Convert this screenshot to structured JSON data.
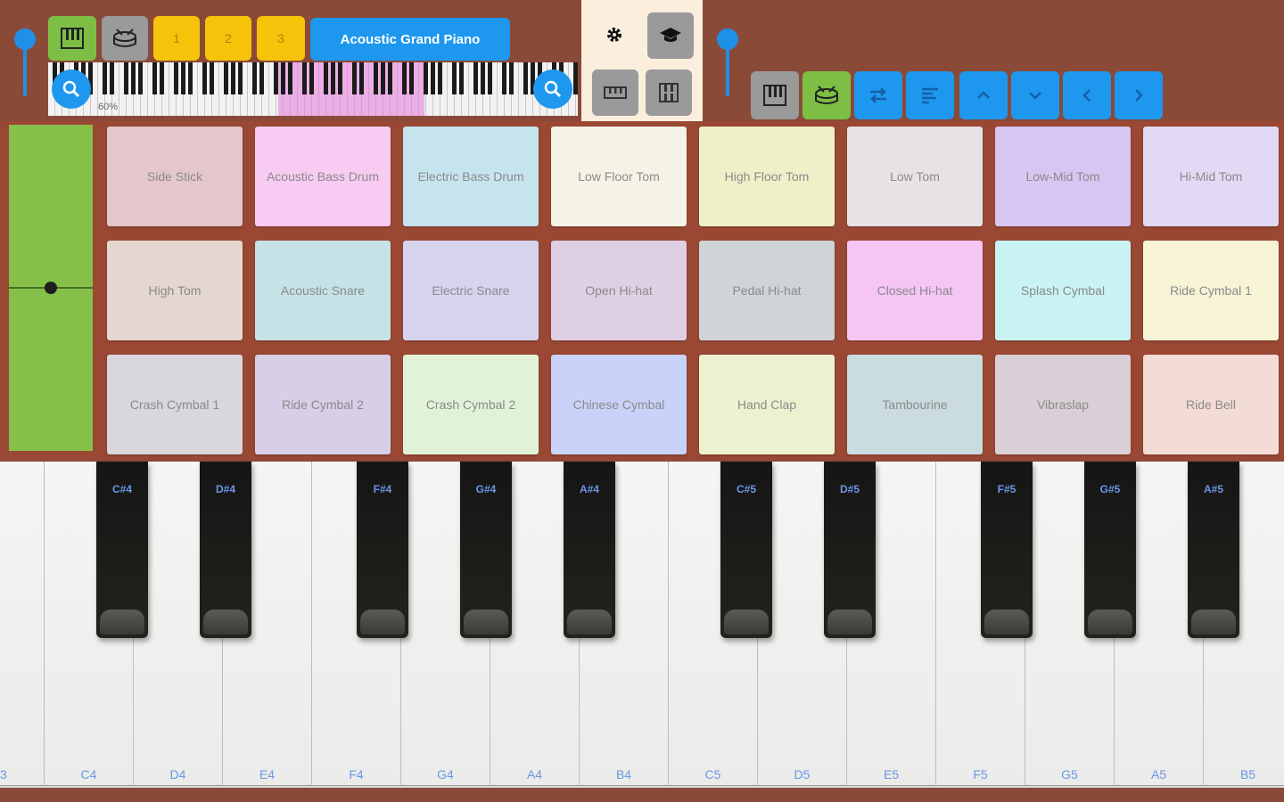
{
  "toolbar": {
    "track_buttons": [
      "1",
      "2",
      "3"
    ],
    "instrument_label": "Acoustic Grand Piano",
    "zoom_percent": "60%"
  },
  "pads": [
    [
      "Side Stick",
      "Acoustic Bass Drum",
      "Electric Bass Drum",
      "Low Floor Tom",
      "High Floor Tom",
      "Low Tom",
      "Low-Mid Tom",
      "Hi-Mid Tom"
    ],
    [
      "High Tom",
      "Acoustic Snare",
      "Electric Snare",
      "Open Hi-hat",
      "Pedal Hi-hat",
      "Closed Hi-hat",
      "Splash Cymbal",
      "Ride Cymbal 1"
    ],
    [
      "Crash Cymbal 1",
      "Ride Cymbal 2",
      "Crash Cymbal 2",
      "Chinese Cymbal",
      "Hand Clap",
      "Tambourine",
      "Vibraslap",
      "Ride Bell"
    ]
  ],
  "pad_colors": [
    [
      "#e4c7cb",
      "#f7cbf2",
      "#c6e4ee",
      "#f4f3e6",
      "#eef1c8",
      "#e7e2e6",
      "#d8c6f2",
      "#e2d9f4"
    ],
    [
      "#e4d7cf",
      "#c5e3e6",
      "#d6d3ef",
      "#dfcfe4",
      "#cfd4d8",
      "#f5c5f4",
      "#c9f3f2",
      "#f6f3d6"
    ],
    [
      "#d9d6de",
      "#d7cfe6",
      "#e1f3d6",
      "#c9d2f8",
      "#eef1cf",
      "#cadce0",
      "#dacfd6",
      "#f4dcd6"
    ]
  ],
  "keyboard": {
    "white_keys": [
      "3",
      "C4",
      "D4",
      "E4",
      "F4",
      "G4",
      "A4",
      "B4",
      "C5",
      "D5",
      "E5",
      "F5",
      "G5",
      "A5",
      "B5"
    ],
    "black_keys": [
      "C#4",
      "D#4",
      "F#4",
      "G#4",
      "A#4",
      "C#5",
      "D#5",
      "F#5",
      "G#5",
      "A#5"
    ]
  }
}
